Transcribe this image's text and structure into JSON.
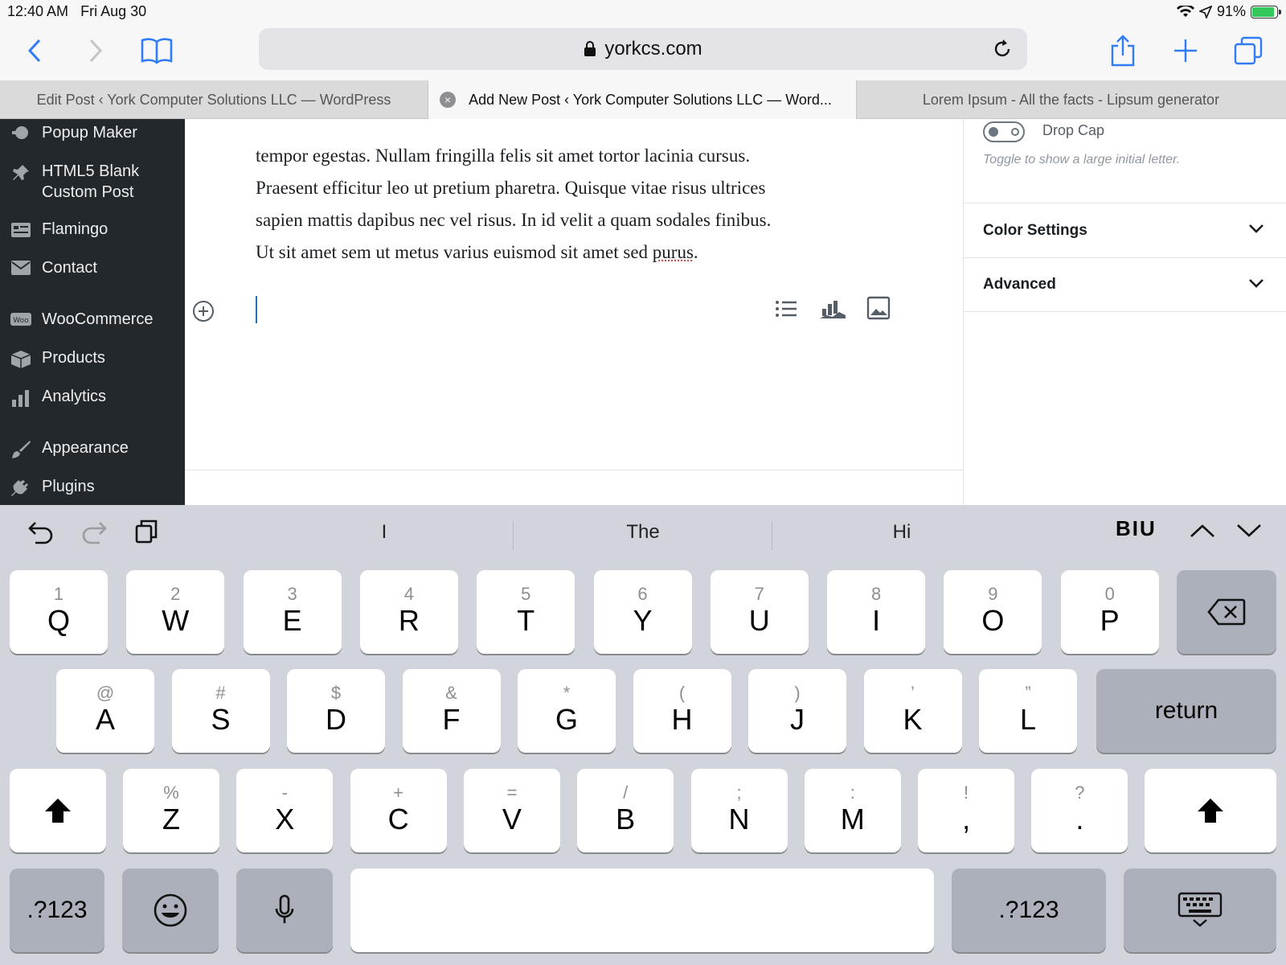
{
  "status": {
    "time": "12:40 AM",
    "date": "Fri Aug 30",
    "battery": "91%"
  },
  "browser": {
    "url": "yorkcs.com",
    "tabs": [
      {
        "title": "Edit Post ‹ York Computer Solutions LLC — WordPress"
      },
      {
        "title": "Add New Post ‹ York Computer Solutions LLC — Word..."
      },
      {
        "title": "Lorem Ipsum - All the facts - Lipsum generator"
      }
    ],
    "close_glyph": "×"
  },
  "wp_menu": [
    {
      "label": "Popup Maker",
      "icon": "popup-icon"
    },
    {
      "label": "HTML5 Blank\nCustom Post",
      "icon": "pin-icon"
    },
    {
      "label": "Flamingo",
      "icon": "flamingo-icon"
    },
    {
      "label": "Contact",
      "icon": "mail-icon"
    },
    {
      "label": "WooCommerce",
      "icon": "woo-icon"
    },
    {
      "label": "Products",
      "icon": "box-icon"
    },
    {
      "label": "Analytics",
      "icon": "chart-icon"
    },
    {
      "label": "Appearance",
      "icon": "brush-icon"
    },
    {
      "label": "Plugins",
      "icon": "plug-icon"
    }
  ],
  "editor": {
    "lines": [
      "tempor egestas. Nullam fringilla felis sit amet tortor lacinia cursus.",
      "Praesent efficitur leo ut pretium pharetra. Quisque vitae risus ultrices",
      "sapien mattis dapibus nec vel risus. In id velit a quam sodales finibus."
    ],
    "last_line_start": "Ut sit amet sem ut metus varius euismod sit amet sed ",
    "last_line_misspelled": "purus",
    "last_line_end": "."
  },
  "settings": {
    "drop_cap_label": "Drop Cap",
    "drop_cap_help": "Toggle to show a large initial letter.",
    "drop_cap_on": false,
    "color_settings": "Color Settings",
    "advanced": "Advanced"
  },
  "keyboard": {
    "suggestions": [
      "I",
      "The",
      "Hi"
    ],
    "format_label": "BIU",
    "row1": [
      {
        "main": "Q",
        "sec": "1"
      },
      {
        "main": "W",
        "sec": "2"
      },
      {
        "main": "E",
        "sec": "3"
      },
      {
        "main": "R",
        "sec": "4"
      },
      {
        "main": "T",
        "sec": "5"
      },
      {
        "main": "Y",
        "sec": "6"
      },
      {
        "main": "U",
        "sec": "7"
      },
      {
        "main": "I",
        "sec": "8"
      },
      {
        "main": "O",
        "sec": "9"
      },
      {
        "main": "P",
        "sec": "0"
      }
    ],
    "row2": [
      {
        "main": "A",
        "sec": "@"
      },
      {
        "main": "S",
        "sec": "#"
      },
      {
        "main": "D",
        "sec": "$"
      },
      {
        "main": "F",
        "sec": "&"
      },
      {
        "main": "G",
        "sec": "*"
      },
      {
        "main": "H",
        "sec": "("
      },
      {
        "main": "J",
        "sec": ")"
      },
      {
        "main": "K",
        "sec": "’"
      },
      {
        "main": "L",
        "sec": "”"
      }
    ],
    "row3": [
      {
        "main": "Z",
        "sec": "%"
      },
      {
        "main": "X",
        "sec": "-"
      },
      {
        "main": "C",
        "sec": "+"
      },
      {
        "main": "V",
        "sec": "="
      },
      {
        "main": "B",
        "sec": "/"
      },
      {
        "main": "N",
        "sec": ";"
      },
      {
        "main": "M",
        "sec": ":"
      },
      {
        "main": ",",
        "sec": "!"
      },
      {
        "main": ".",
        "sec": "?"
      }
    ],
    "return_label": "return",
    "numbers_label": ".?123"
  }
}
